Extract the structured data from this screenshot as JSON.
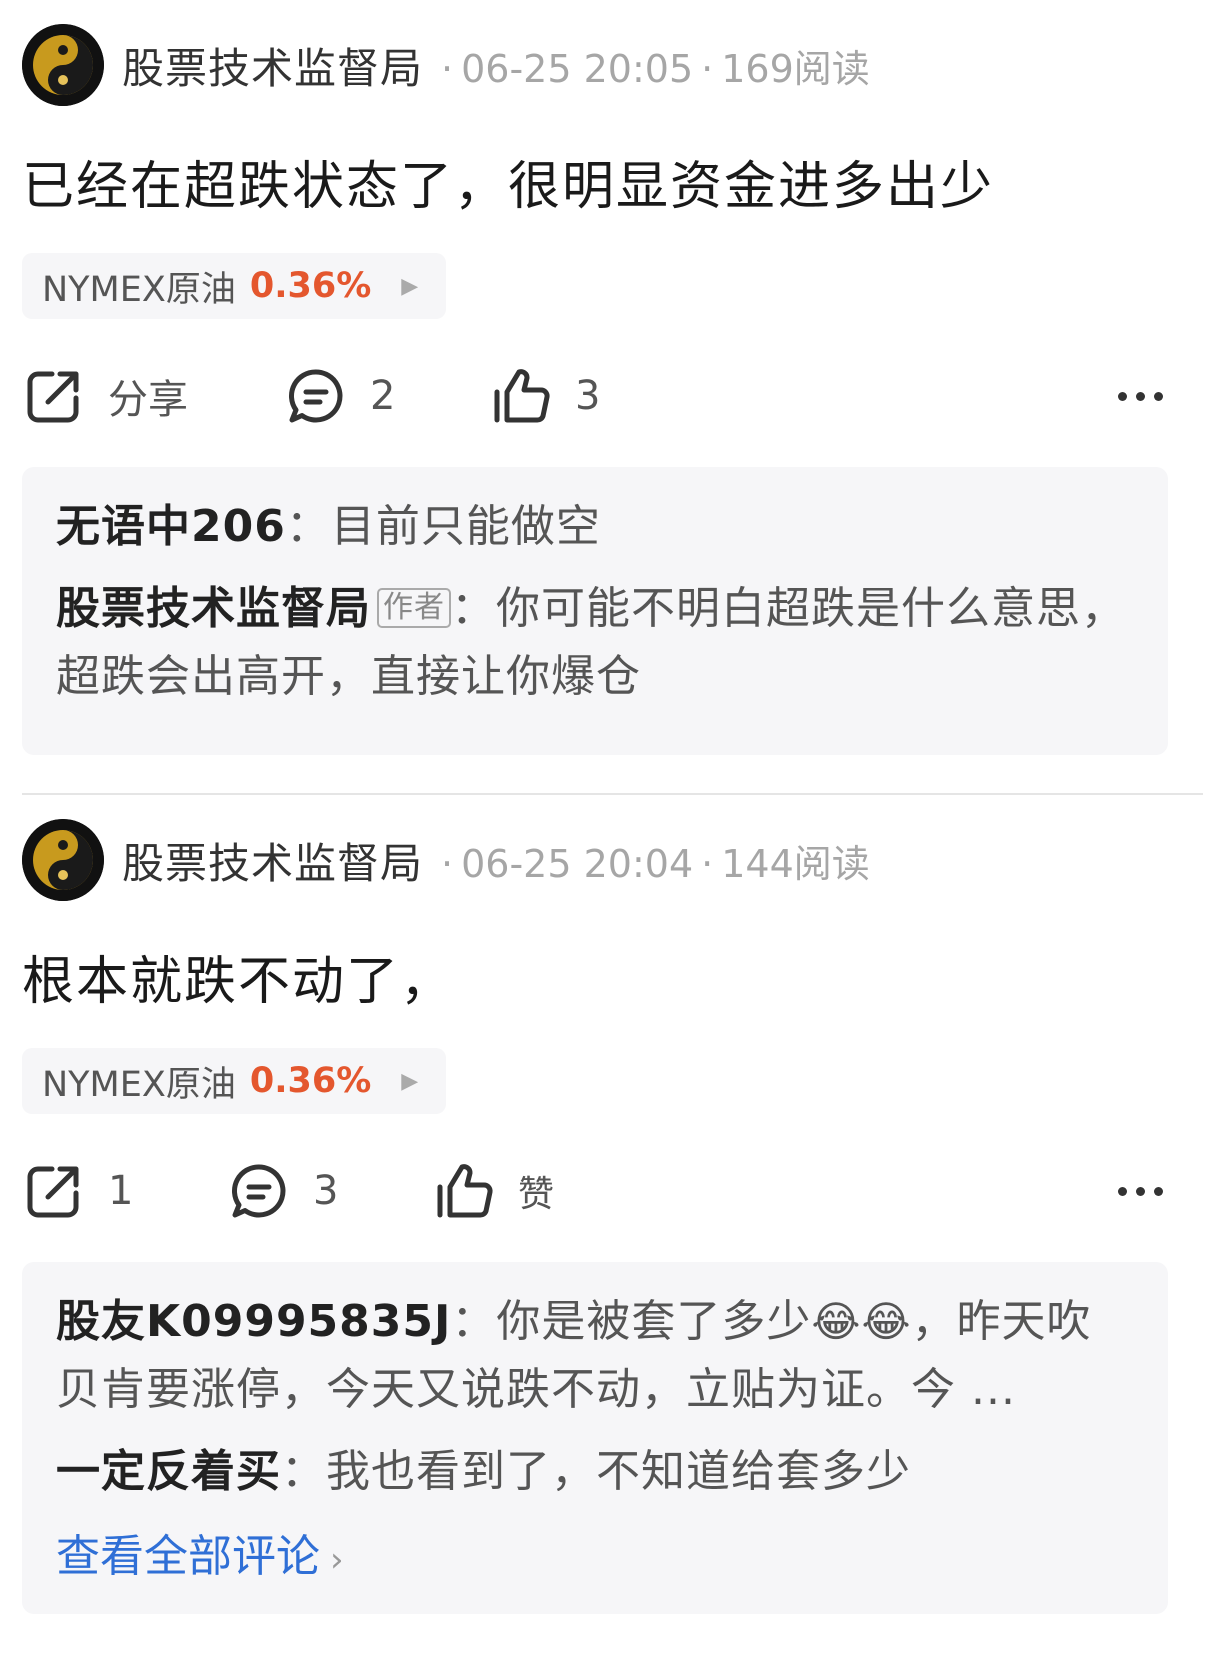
{
  "posts": [
    {
      "author": "股票技术监督局",
      "meta_separator": "·",
      "time": "06-25 20:05",
      "reads": "169阅读",
      "content": "已经在超跌状态了，很明显资金进多出少",
      "stock": {
        "name": "NYMEX原油",
        "change": "0.36%",
        "arrow": "▶"
      },
      "actions": {
        "share": "分享",
        "comments": "2",
        "likes": "3"
      },
      "comments": [
        {
          "user": "无语中206",
          "sep": "：",
          "text": "目前只能做空"
        },
        {
          "user": "股票技术监督局",
          "badge": "作者",
          "sep": "：",
          "text": "你可能不明白超跌是什么意思，超跌会出高开，直接让你爆仓"
        }
      ]
    },
    {
      "author": "股票技术监督局",
      "meta_separator": "·",
      "time": "06-25 20:04",
      "reads": "144阅读",
      "content": "根本就跌不动了，",
      "stock": {
        "name": "NYMEX原油",
        "change": "0.36%",
        "arrow": "▶"
      },
      "actions": {
        "share": "1",
        "comments": "3",
        "likes": "赞"
      },
      "comments": [
        {
          "user": "股友K09995835J",
          "sep": "：",
          "text_a": "你是被套了多少",
          "emoji": "😂😂",
          "text_b": "，昨天吹贝肯要涨停，今天又说跌不动，立贴为证。今 ..."
        },
        {
          "user": "一定反着买",
          "sep": "：",
          "text": "我也看到了，不知道给套多少"
        }
      ],
      "view_all": "查看全部评论",
      "view_all_chevron": "›"
    }
  ],
  "colors": {
    "accent_red": "#e4572e",
    "link_blue": "#2f6fd6",
    "card_bg": "#f6f6f8"
  },
  "icons": [
    "share-icon",
    "comment-icon",
    "thumbs-up-icon",
    "more-icon",
    "avatar-yin-yang-icon"
  ]
}
